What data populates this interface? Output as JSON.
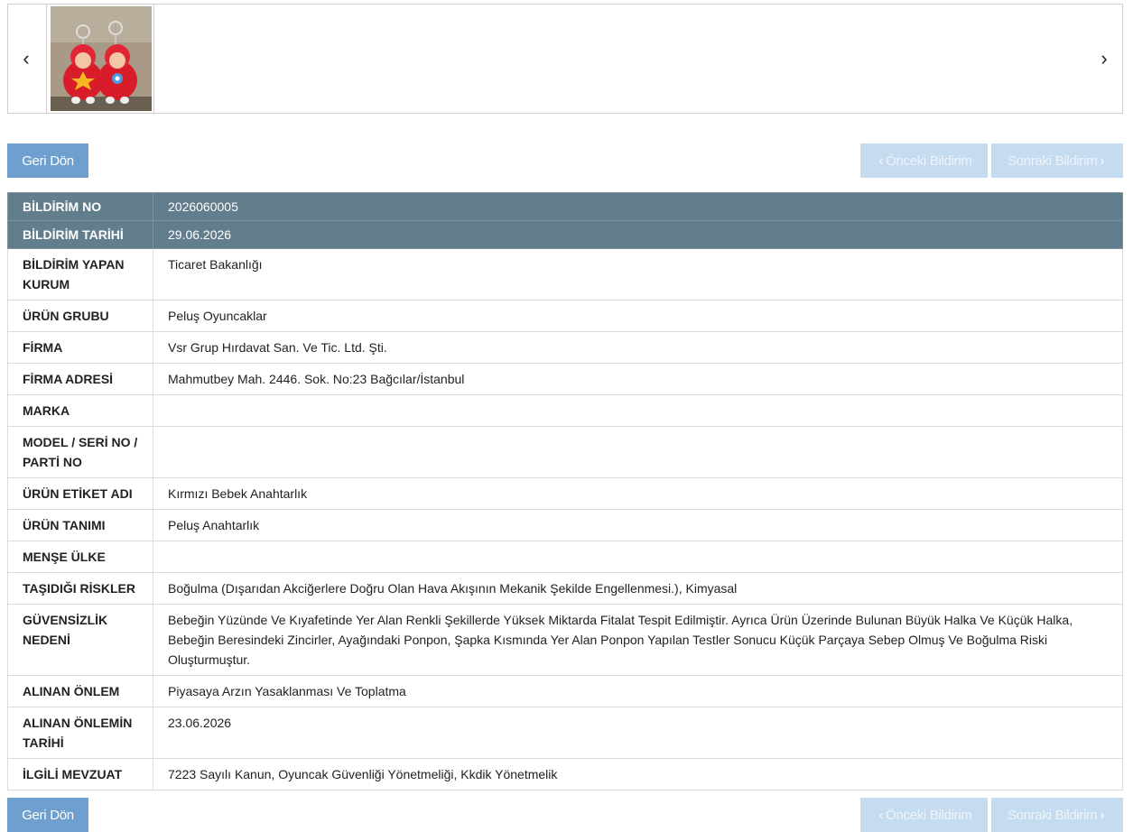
{
  "gallery": {
    "prev_glyph": "‹",
    "next_glyph": "›",
    "thumbnail_icon": "plush-keychain-photo"
  },
  "actions": {
    "back_label": "Geri Dön",
    "previous_label": "Önceki Bildirim",
    "next_label": "Sonraki Bildirim",
    "previous_icon": "chevron-left-icon",
    "next_icon": "chevron-right-icon"
  },
  "details": {
    "rows": [
      {
        "label": "BİLDİRİM NO",
        "value": "2026060005"
      },
      {
        "label": "BİLDİRİM TARİHİ",
        "value": "29.06.2026"
      },
      {
        "label": "BİLDİRİM YAPAN KURUM",
        "value": "Ticaret Bakanlığı"
      },
      {
        "label": "ÜRÜN GRUBU",
        "value": "Peluş Oyuncaklar"
      },
      {
        "label": "FİRMA",
        "value": "Vsr Grup Hırdavat San. Ve Tic. Ltd. Şti."
      },
      {
        "label": "FİRMA ADRESİ",
        "value": "Mahmutbey Mah. 2446. Sok. No:23 Bağcılar/İstanbul"
      },
      {
        "label": "MARKA",
        "value": ""
      },
      {
        "label": "MODEL / SERİ NO / PARTİ NO",
        "value": ""
      },
      {
        "label": "ÜRÜN ETİKET ADI",
        "value": "Kırmızı Bebek Anahtarlık"
      },
      {
        "label": "ÜRÜN TANIMI",
        "value": "Peluş Anahtarlık"
      },
      {
        "label": "MENŞE ÜLKE",
        "value": ""
      },
      {
        "label": "TAŞIDIĞI RİSKLER",
        "value": "Boğulma (Dışarıdan Akciğerlere Doğru Olan Hava Akışının Mekanik Şekilde Engellenmesi.), Kimyasal"
      },
      {
        "label": "GÜVENSİZLİK NEDENİ",
        "value": "Bebeğin Yüzünde Ve Kıyafetinde Yer Alan Renkli Şekillerde Yüksek Miktarda Fitalat Tespit Edilmiştir. Ayrıca Ürün Üzerinde Bulunan Büyük Halka Ve Küçük Halka, Bebeğin Beresindeki Zincirler, Ayağındaki Ponpon, Şapka Kısmında Yer Alan Ponpon Yapılan Testler Sonucu Küçük Parçaya Sebep Olmuş Ve Boğulma Riski Oluşturmuştur."
      },
      {
        "label": "ALINAN ÖNLEM",
        "value": "Piyasaya Arzın Yasaklanması Ve Toplatma"
      },
      {
        "label": "ALINAN ÖNLEMİN TARİHİ",
        "value": "23.06.2026"
      },
      {
        "label": "İLGİLİ MEVZUAT",
        "value": "7223 Sayılı Kanun, Oyuncak Güvenliği Yönetmeliği, Kkdik Yönetmelik"
      }
    ]
  }
}
